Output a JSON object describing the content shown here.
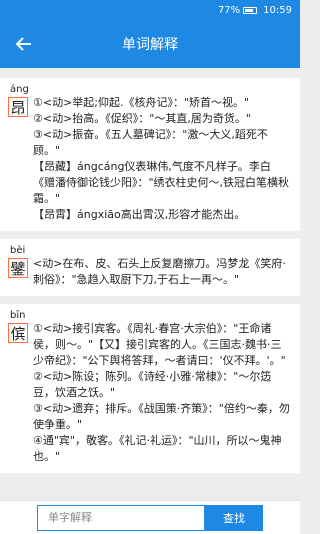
{
  "status": {
    "battery": "77%",
    "time": "10:59"
  },
  "header": {
    "title": "单词解释"
  },
  "entries": [
    {
      "pinyin": "áng",
      "char": "昂",
      "lines": [
        "①<动>举起;仰起.《核舟记》：\"矫首～视。\"",
        "②<动>抬高。《促织》：\"～其直,居为奇货。\"",
        "③<动>振奋。《五人墓碑记》：\"激～大义,蹈死不顾。\"",
        "【昂藏】ángcáng仪表琳伟,气度不凡样子。李白《赠潘侍御论钱少阳》：\"绣衣柱史何～,铁冠白笔横秋霜。\"",
        "【昂霄】ángxiāo高出霄汉,形容才能杰出。"
      ]
    },
    {
      "pinyin": "bèi",
      "char": "鐾",
      "lines": [
        "<动>在布、皮、石头上反复磨擦刀。冯梦龙《笑府·刺俗》：\"急趋入取厨下刀,于石上一再～。\""
      ]
    },
    {
      "pinyin": "bīn",
      "char": "傧",
      "lines": [
        "①<动>接引宾客。《周礼·春宫·大宗伯》：\"王命诸侯，则～。\"【又】接引宾客的人。《三国志·魏书·三少帝纪》：\"公下舆将答拜，～者请曰：'仪不拜。'。\"",
        "②<动>陈设；陈列。《诗经·小雅·常棣》：\"～尔笾豆，饮酒之饫。\"",
        "③<动>遗弃；排斥。《战国策·齐策》：\"倍约～秦，勿使争重。\"",
        "④通\"宾\"，敬客。《礼记·礼运》：\"山川，所以～鬼神也。\""
      ]
    }
  ],
  "search": {
    "placeholder": "单字解释",
    "button_label": "查找"
  }
}
